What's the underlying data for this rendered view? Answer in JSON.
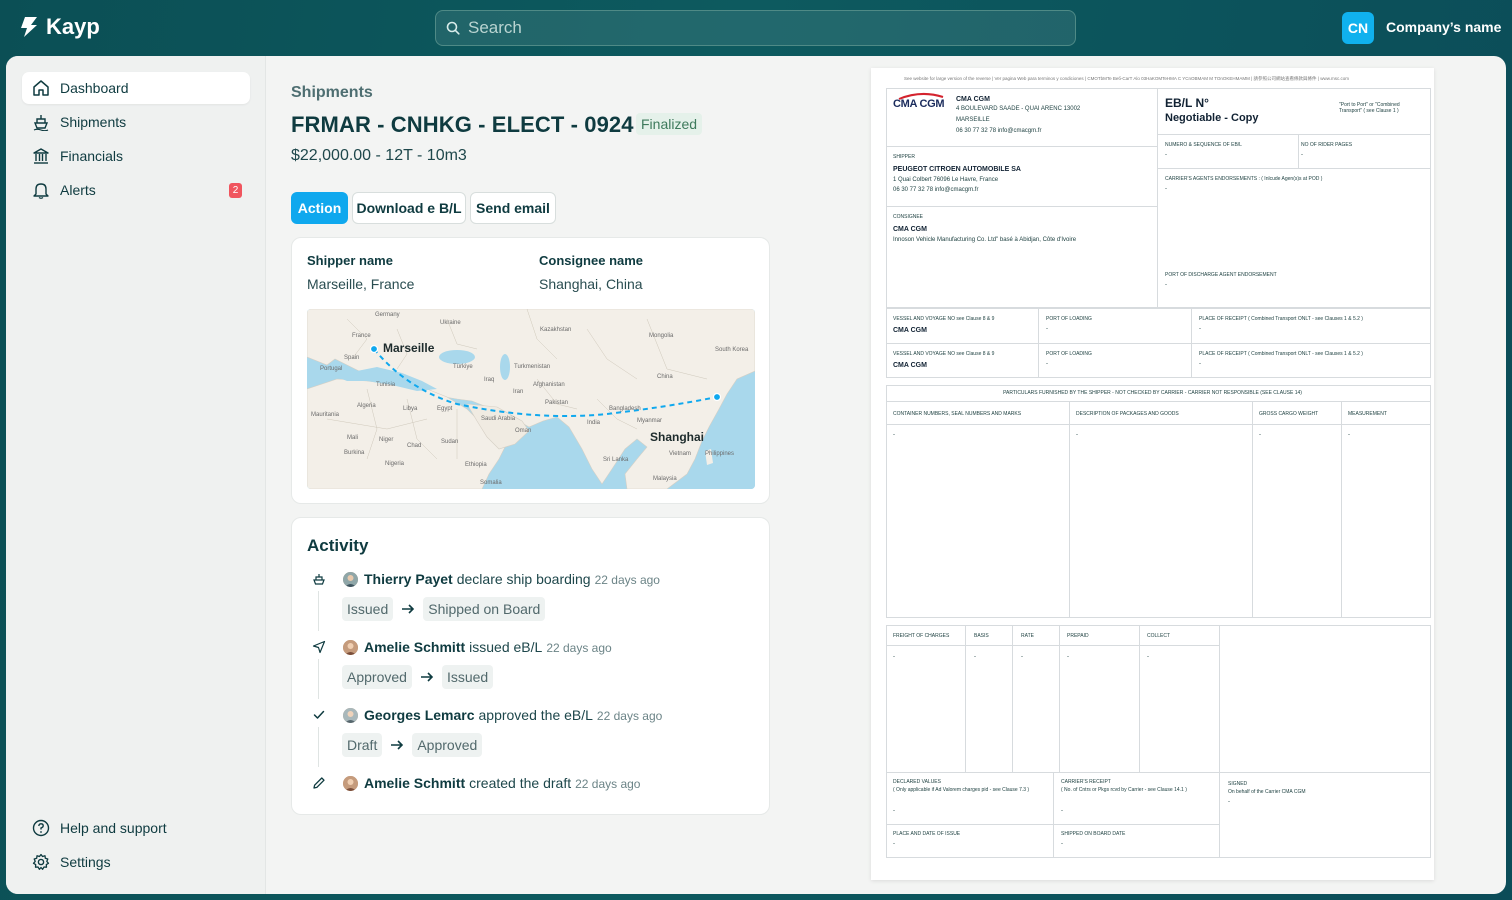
{
  "app": {
    "name": "Kayp"
  },
  "search": {
    "placeholder": "Search"
  },
  "account": {
    "initials": "CN",
    "company": "Company’s name"
  },
  "sidebar": {
    "items": [
      {
        "label": "Dashboard",
        "icon": "home-icon"
      },
      {
        "label": "Shipments",
        "icon": "ship-icon"
      },
      {
        "label": "Financials",
        "icon": "bank-icon"
      },
      {
        "label": "Alerts",
        "icon": "bell-icon",
        "badge": "2"
      }
    ],
    "footer": [
      {
        "label": "Help and support",
        "icon": "help-circle-icon"
      },
      {
        "label": "Settings",
        "icon": "gear-icon"
      }
    ]
  },
  "page": {
    "breadcrumb": "Shipments",
    "title": "FRMAR - CNHKG - ELECT - 0924",
    "status": "Finalized",
    "summary": "$22,000.00 - 12T - 10m3",
    "actions": {
      "action": "Action",
      "download": "Download e B/L",
      "email": "Send email"
    }
  },
  "route": {
    "shipper_label": "Shipper name",
    "shipper_value": "Marseille, France",
    "consignee_label": "Consignee name",
    "consignee_value": "Shanghai, China",
    "origin": "Marseille",
    "destination": "Shanghai",
    "map_labels": [
      "France",
      "Germany",
      "Ukraine",
      "Kazakhstan",
      "Mongolia",
      "Spain",
      "Portugal",
      "Türkiye",
      "Turkmenistan",
      "Iraq",
      "Iran",
      "Afghanistan",
      "China",
      "South Korea",
      "Tunisia",
      "Algeria",
      "Libya",
      "Egypt",
      "Saudi Arabia",
      "Oman",
      "Pakistan",
      "India",
      "Bangladesh",
      "Myanmar",
      "Vietnam",
      "Philippines",
      "Mali",
      "Niger",
      "Chad",
      "Sudan",
      "Ethiopia",
      "Burkina",
      "Nigeria",
      "Somalia",
      "Malaysia",
      "Mauritania",
      "Sri Lanka"
    ]
  },
  "activity": {
    "title": "Activity",
    "events": [
      {
        "icon": "ship-icon",
        "user": "Thierry Payet",
        "action": "declare ship boarding",
        "time": "22 days ago",
        "from": "Issued",
        "to": "Shipped on Board"
      },
      {
        "icon": "send-icon",
        "user": "Amelie Schmitt",
        "action": "issued eB/L",
        "time": "22 days ago",
        "from": "Approved",
        "to": "Issued"
      },
      {
        "icon": "check-icon",
        "user": "Georges Lemarc",
        "action": "approved the eB/L",
        "time": "22 days ago",
        "from": "Draft",
        "to": "Approved"
      },
      {
        "icon": "pencil-icon",
        "user": "Amelie Schmitt",
        "action": "created the draft",
        "time": "22 days ago"
      }
    ]
  },
  "document": {
    "header_note": "See website for large version of the reverse | Ver pagina Web para terminos y condiciones | CMOTbMTe Beб-CarT Alo 03HaKOMTeHMA C YCnOBMAM M TOnOKEHMAMM | 請参照公司網站查看條款與條件 | www.msc.com",
    "logo": "CMA CGM",
    "carrier": {
      "name": "CMA CGM",
      "address1": "4 BOULEVARD SAADE - QUAI ARENC 13002",
      "address2": "MARSEILLE",
      "contact": "06 30 77 32 78 info@cmacgm.fr"
    },
    "bl_title": "EB/L N°",
    "bl_subtitle": "Negotiable - Copy",
    "bl_note": "\"Port to Port\" or \"Combined Transport\" ( see Clause 1 )",
    "shipper_label": "SHIPPER",
    "shipper": {
      "name": "PEUGEOT CITROEN AUTOMOBILE SA",
      "address": "1 Quai Colbert 76096 Le Havre, France",
      "contact": "06 30 77 32 78 info@cmacgm.fr"
    },
    "consignee_label": "CONSIGNEE",
    "consignee": {
      "name": "CMA CGM",
      "address": "Innoson Vehicle Manufacturing Co. Ltd\" basé à Abidjan, Côte d'Ivoire"
    },
    "numero_label": "NUMERO & SEQUENCE OF EB/L",
    "rider_label": "NO OF RIDER PAGES",
    "agents_label": "CARRIER'S AGENTS ENDORSEMENTS :   ( Inlcude Agen(s)s at POD )",
    "discharge_label": "PORT OF DISCHARGE AGENT ENDORSEMENT",
    "vessel_label": "VESSEL AND VOYAGE NO   see Clause 8 & 9",
    "vessel_value": "CMA CGM",
    "loading_label": "PORT OF LOADING",
    "receipt_label": "PLACE OF RECEIPT   ( Combined Transport ONLT - see Clauses 1 & 5.2 )",
    "dash": "-",
    "particulars_title": "PARTICULARS FURNISHED BY THE SHIPPER - NOT CHECKED BY CARRIER - CARRIER NOT RESPONSIBLE (SEE CLAUSE 14)",
    "particulars_cols": [
      "CONTAINER NUMBERS, SEAL NUMBERS AND MARKS",
      "DESCRIPTION OF PACKAGES AND GOODS",
      "GROSS CARGO WEIGHT",
      "MEASUREMENT"
    ],
    "charges_cols": [
      "FREIGHT OF CHARGES",
      "BASIS",
      "RATE",
      "PREPAID",
      "COLLECT"
    ],
    "declared_label": "DECLARED VALUES",
    "declared_note": "( Only applicable if Ad Valorem charges pid - see Clause 7.3 )",
    "carrier_receipt_label": "CARRIER'S RECEIPT",
    "carrier_receipt_note": "( No. of Cntrs or Pkgs rcvd by Carrier - see Clause 14.1 )",
    "signed_label": "SIGNED",
    "signed_note": "On behalf of the Carrier CMA CGM",
    "place_issue_label": "PLACE AND DATE OF ISSUE",
    "shipped_date_label": "SHIPPED ON BOARD DATE"
  },
  "colors": {
    "brand_dark": "#0b4f55",
    "accent": "#0fa8ee",
    "alert": "#f0555e",
    "status_bg": "#e5f1ea"
  }
}
